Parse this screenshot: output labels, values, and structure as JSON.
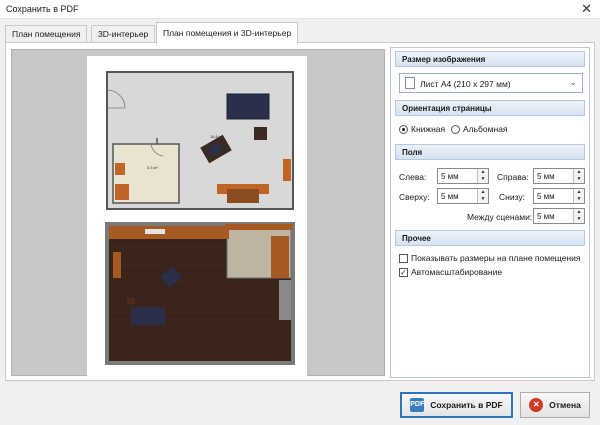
{
  "window": {
    "title": "Сохранить в PDF",
    "close_glyph": "✕"
  },
  "tabs": [
    {
      "label": "План помещения"
    },
    {
      "label": "3D-интерьер"
    },
    {
      "label": "План помещения и 3D-интерьер",
      "active": true
    }
  ],
  "preview": {
    "floorplan_labels": {
      "main_room_area": "16.8 м²",
      "small_room_area": "5.5 м²"
    }
  },
  "settings": {
    "image_size": {
      "header": "Размер изображения",
      "value": "Лист A4 (210 x 297 мм)",
      "icon": "document-icon"
    },
    "orientation": {
      "header": "Ориентация страницы",
      "options": [
        {
          "label": "Книжная",
          "selected": true
        },
        {
          "label": "Альбомная",
          "selected": false
        }
      ]
    },
    "margins": {
      "header": "Поля",
      "left_label": "Слева:",
      "left_value": "5 мм",
      "right_label": "Справа:",
      "right_value": "5 мм",
      "top_label": "Сверху:",
      "top_value": "5 мм",
      "bottom_label": "Снизу:",
      "bottom_value": "5 мм",
      "between_label": "Между сценами:",
      "between_value": "5 мм"
    },
    "other": {
      "header": "Прочее",
      "show_sizes": {
        "label": "Показывать размеры на плане помещения",
        "checked": false
      },
      "autoscale": {
        "label": "Автомасштабирование",
        "checked": true,
        "mark": "✓"
      }
    }
  },
  "buttons": {
    "save": {
      "label": "Сохранить в PDF",
      "icon": "PDF"
    },
    "cancel": {
      "label": "Отмена",
      "icon": "✕"
    }
  },
  "colors": {
    "accent": "#2b75c5",
    "floor_wood": "#3b2419",
    "sofa": "#2a2f4a"
  },
  "spinner_arrows": {
    "up": "▲",
    "down": "▼"
  },
  "dropdown_chevron": "⌄"
}
